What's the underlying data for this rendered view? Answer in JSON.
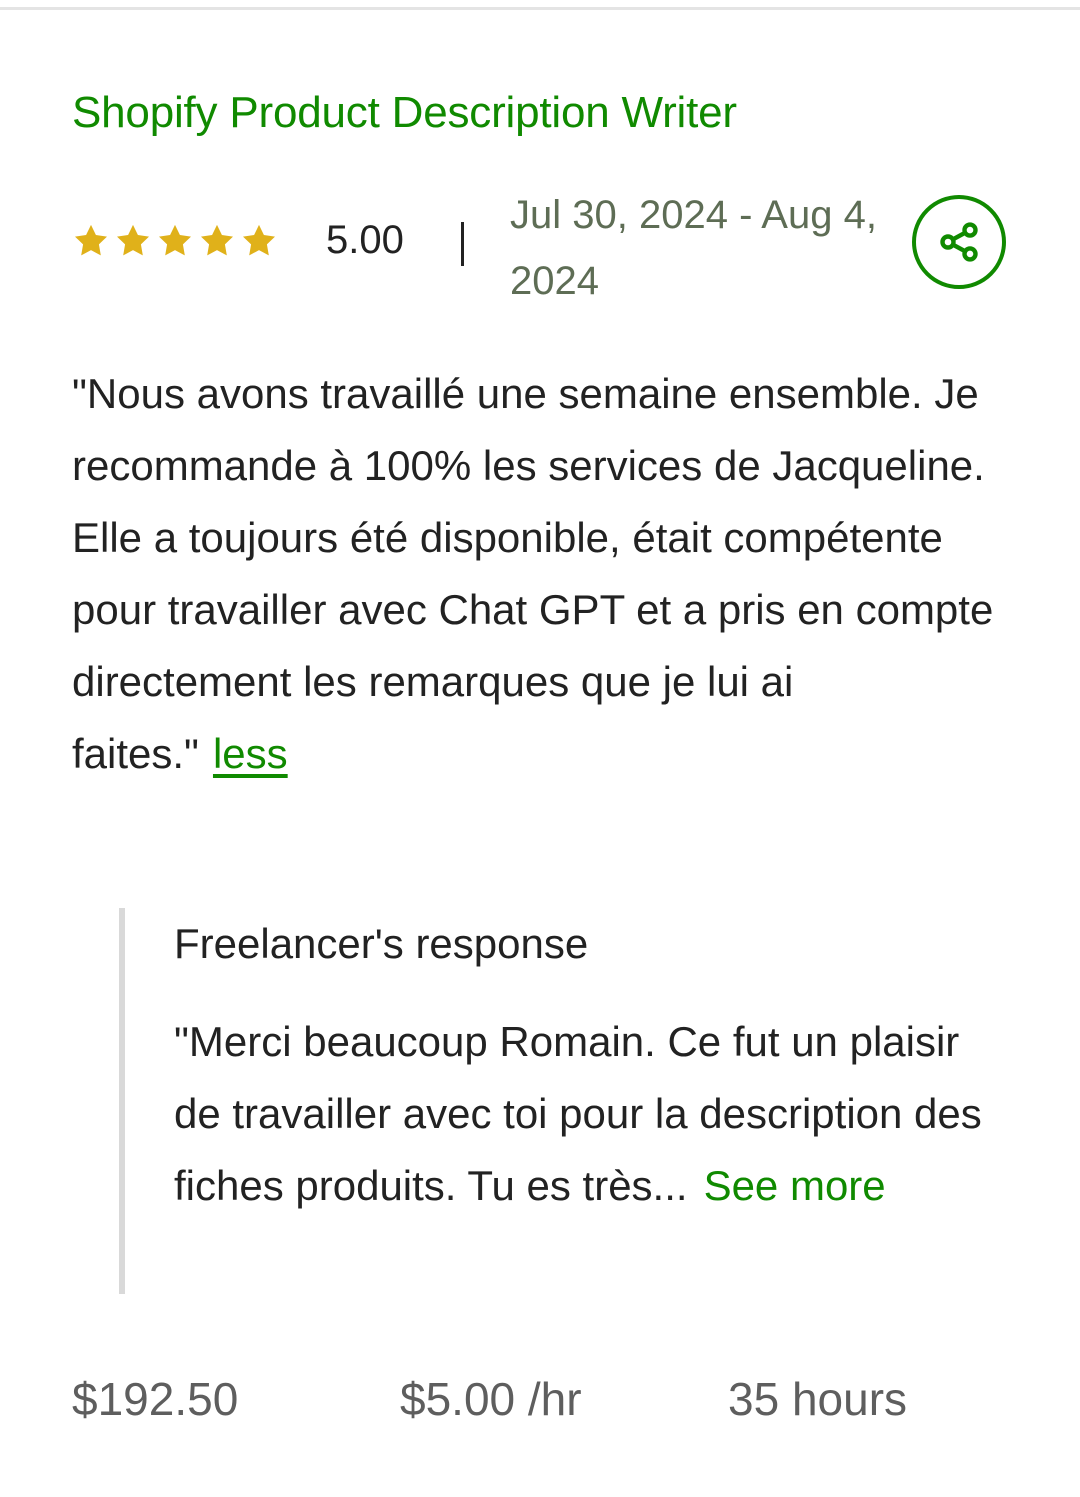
{
  "job": {
    "title": "Shopify Product Description Writer"
  },
  "rating": {
    "stars": 5,
    "max_stars": 5,
    "value_text": "5.00",
    "star_color": "#e0b11a"
  },
  "date_range": "Jul 30, 2024 - Aug 4, 2024",
  "share": {
    "icon": "share-icon",
    "color": "#108a00"
  },
  "review": {
    "text": "\"Nous avons travaillé une semaine ensemble. Je recommande à 100% les services de Jacqueline. Elle a toujours été disponible, était compétente pour travailler avec Chat GPT et a pris en compte directement les remarques que je lui ai faites.\"",
    "less_label": "less"
  },
  "freelancer_response": {
    "heading": "Freelancer's response",
    "text": "\"Merci beaucoup Romain. Ce fut un plaisir de travailler avec toi pour la description des fiches produits. Tu es très...",
    "see_more_label": "See more"
  },
  "stats": {
    "total": "$192.50",
    "rate": "$5.00 /hr",
    "hours": "35 hours"
  },
  "colors": {
    "accent": "#108a00",
    "text": "#222222",
    "muted": "#5e5e5e"
  }
}
